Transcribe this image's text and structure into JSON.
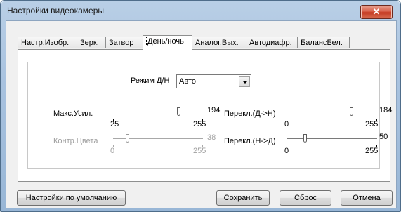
{
  "window": {
    "title": "Настройки видеокамеры",
    "close_glyph": "✕"
  },
  "tabs": [
    {
      "label": "Настр.Изобр.",
      "active": false
    },
    {
      "label": "Зерк.",
      "active": false
    },
    {
      "label": "Затвор",
      "active": false
    },
    {
      "label": "День/ночь",
      "active": true
    },
    {
      "label": "Аналог.Вых.",
      "active": false
    },
    {
      "label": "Автодиафр.",
      "active": false
    },
    {
      "label": "БалансБел.",
      "active": false
    }
  ],
  "panel": {
    "mode": {
      "label": "Режим Д/Н",
      "value": "Авто"
    },
    "sliders": {
      "max_gain": {
        "label": "Макс.Усил.",
        "value": "194",
        "min": "25",
        "max": "255",
        "position": 0.737,
        "enabled": true
      },
      "color_contrast": {
        "label": "Контр.Цвета",
        "value": "38",
        "min": "0",
        "max": "255",
        "position": 0.149,
        "enabled": false
      },
      "switch_day_night": {
        "label": "Перекл.(Д->Н)",
        "value": "184",
        "min": "0",
        "max": "255",
        "position": 0.722,
        "enabled": true
      },
      "switch_night_day": {
        "label": "Перекл.(Н->Д)",
        "value": "50",
        "min": "0",
        "max": "255",
        "position": 0.196,
        "enabled": true
      }
    }
  },
  "buttons": {
    "defaults": "Настройки по умолчанию",
    "save": "Сохранить",
    "reset": "Сброс",
    "cancel": "Отмена"
  }
}
